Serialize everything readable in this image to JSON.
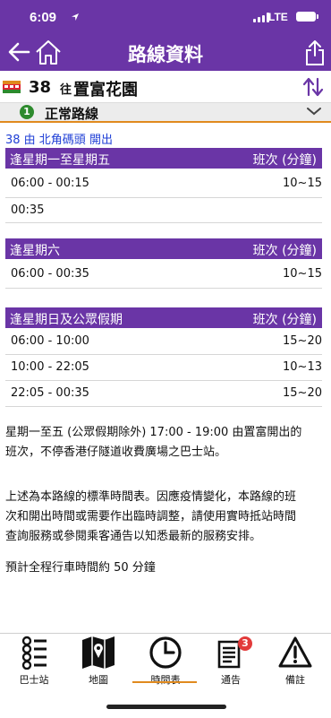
{
  "status_bar": {
    "time": "6:09",
    "network": "LTE"
  },
  "header": {
    "title": "路線資料",
    "icons": [
      "back-arrow-icon",
      "home-icon",
      "share-icon"
    ]
  },
  "route": {
    "number": "38",
    "dest_prefix": "往",
    "destination": "置富花園",
    "icons": [
      "bus-icon",
      "swap-direction-icon"
    ]
  },
  "variant": {
    "badge": "1",
    "label": "正常路線"
  },
  "origin_text": "38 由 北角碼頭 開出",
  "sections": [
    {
      "title": "逢星期一至星期五",
      "freq_header": "班次 (分鐘)",
      "rows": [
        {
          "time": "06:00 - 00:15",
          "freq": "10~15"
        },
        {
          "time": "00:35",
          "freq": ""
        }
      ]
    },
    {
      "title": "逢星期六",
      "freq_header": "班次 (分鐘)",
      "rows": [
        {
          "time": "06:00 - 00:35",
          "freq": "10~15"
        }
      ]
    },
    {
      "title": "逢星期日及公眾假期",
      "freq_header": "班次 (分鐘)",
      "rows": [
        {
          "time": "06:00 - 10:00",
          "freq": "15~20"
        },
        {
          "time": "10:00 - 22:05",
          "freq": "10~13"
        },
        {
          "time": "22:05 - 00:35",
          "freq": "15~20"
        }
      ]
    }
  ],
  "notes": {
    "n1_line1": "星期一至五 (公眾假期除外) 17:00 - 19:00 由置富開出的",
    "n1_line2": "班次，不停香港仔隧道收費廣場之巴士站。",
    "n2_line1": "上述為本路線的標準時間表。因應疫情變化，本路線的班",
    "n2_line2": "次和開出時間或需要作出臨時調整，請使用實時抵站時間",
    "n2_line3": "查詢服務或參閱乘客通告以知悉最新的服務安排。",
    "n3": "預計全程行車時間約 50 分鐘"
  },
  "tabs": [
    {
      "label": "巴士站",
      "icon": "bus-stops-icon"
    },
    {
      "label": "地圖",
      "icon": "map-icon"
    },
    {
      "label": "時間表",
      "icon": "clock-icon"
    },
    {
      "label": "通告",
      "icon": "notice-icon",
      "badge": "3"
    },
    {
      "label": "備註",
      "icon": "warning-icon"
    }
  ],
  "colors": {
    "header": "#6a35a6",
    "accent": "#e08a1e",
    "link": "#1f3fd6",
    "badge": "#e23a3a",
    "route_ok": "#2d8a2d"
  }
}
